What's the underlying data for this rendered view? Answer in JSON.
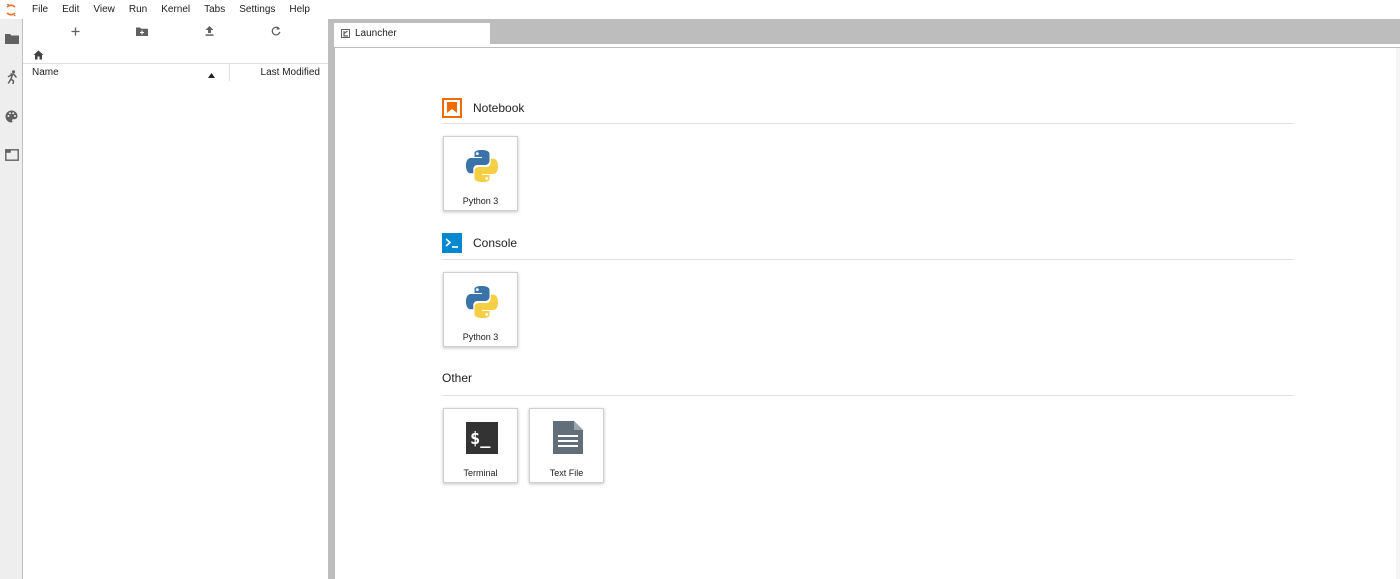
{
  "menubar": {
    "items": [
      "File",
      "Edit",
      "View",
      "Run",
      "Kernel",
      "Tabs",
      "Settings",
      "Help"
    ]
  },
  "activitybar": {
    "icons": [
      "folder-icon",
      "running-icon",
      "palette-icon",
      "tabs-icon"
    ]
  },
  "filebrowser": {
    "toolbar": [
      "new-launcher-icon",
      "new-folder-icon",
      "upload-icon",
      "refresh-icon"
    ],
    "breadcrumb_icon": "home-icon",
    "columns": {
      "name": "Name",
      "last_modified": "Last Modified"
    }
  },
  "tabs": [
    {
      "label": "Launcher"
    }
  ],
  "launcher": {
    "sections": [
      {
        "title": "Notebook",
        "cards": [
          {
            "label": "Python 3",
            "icon": "python-icon"
          }
        ]
      },
      {
        "title": "Console",
        "cards": [
          {
            "label": "Python 3",
            "icon": "python-icon"
          }
        ]
      },
      {
        "title": "Other",
        "cards": [
          {
            "label": "Terminal",
            "icon": "terminal-icon"
          },
          {
            "label": "Text File",
            "icon": "text-file-icon"
          }
        ]
      }
    ]
  },
  "colors": {
    "notebook_accent": "#ef6c00",
    "console_accent": "#0288d1",
    "terminal_bg": "#333333",
    "textfile_icon": "#616f7a",
    "python_blue": "#3a73a8",
    "python_yellow": "#f5cf43"
  }
}
